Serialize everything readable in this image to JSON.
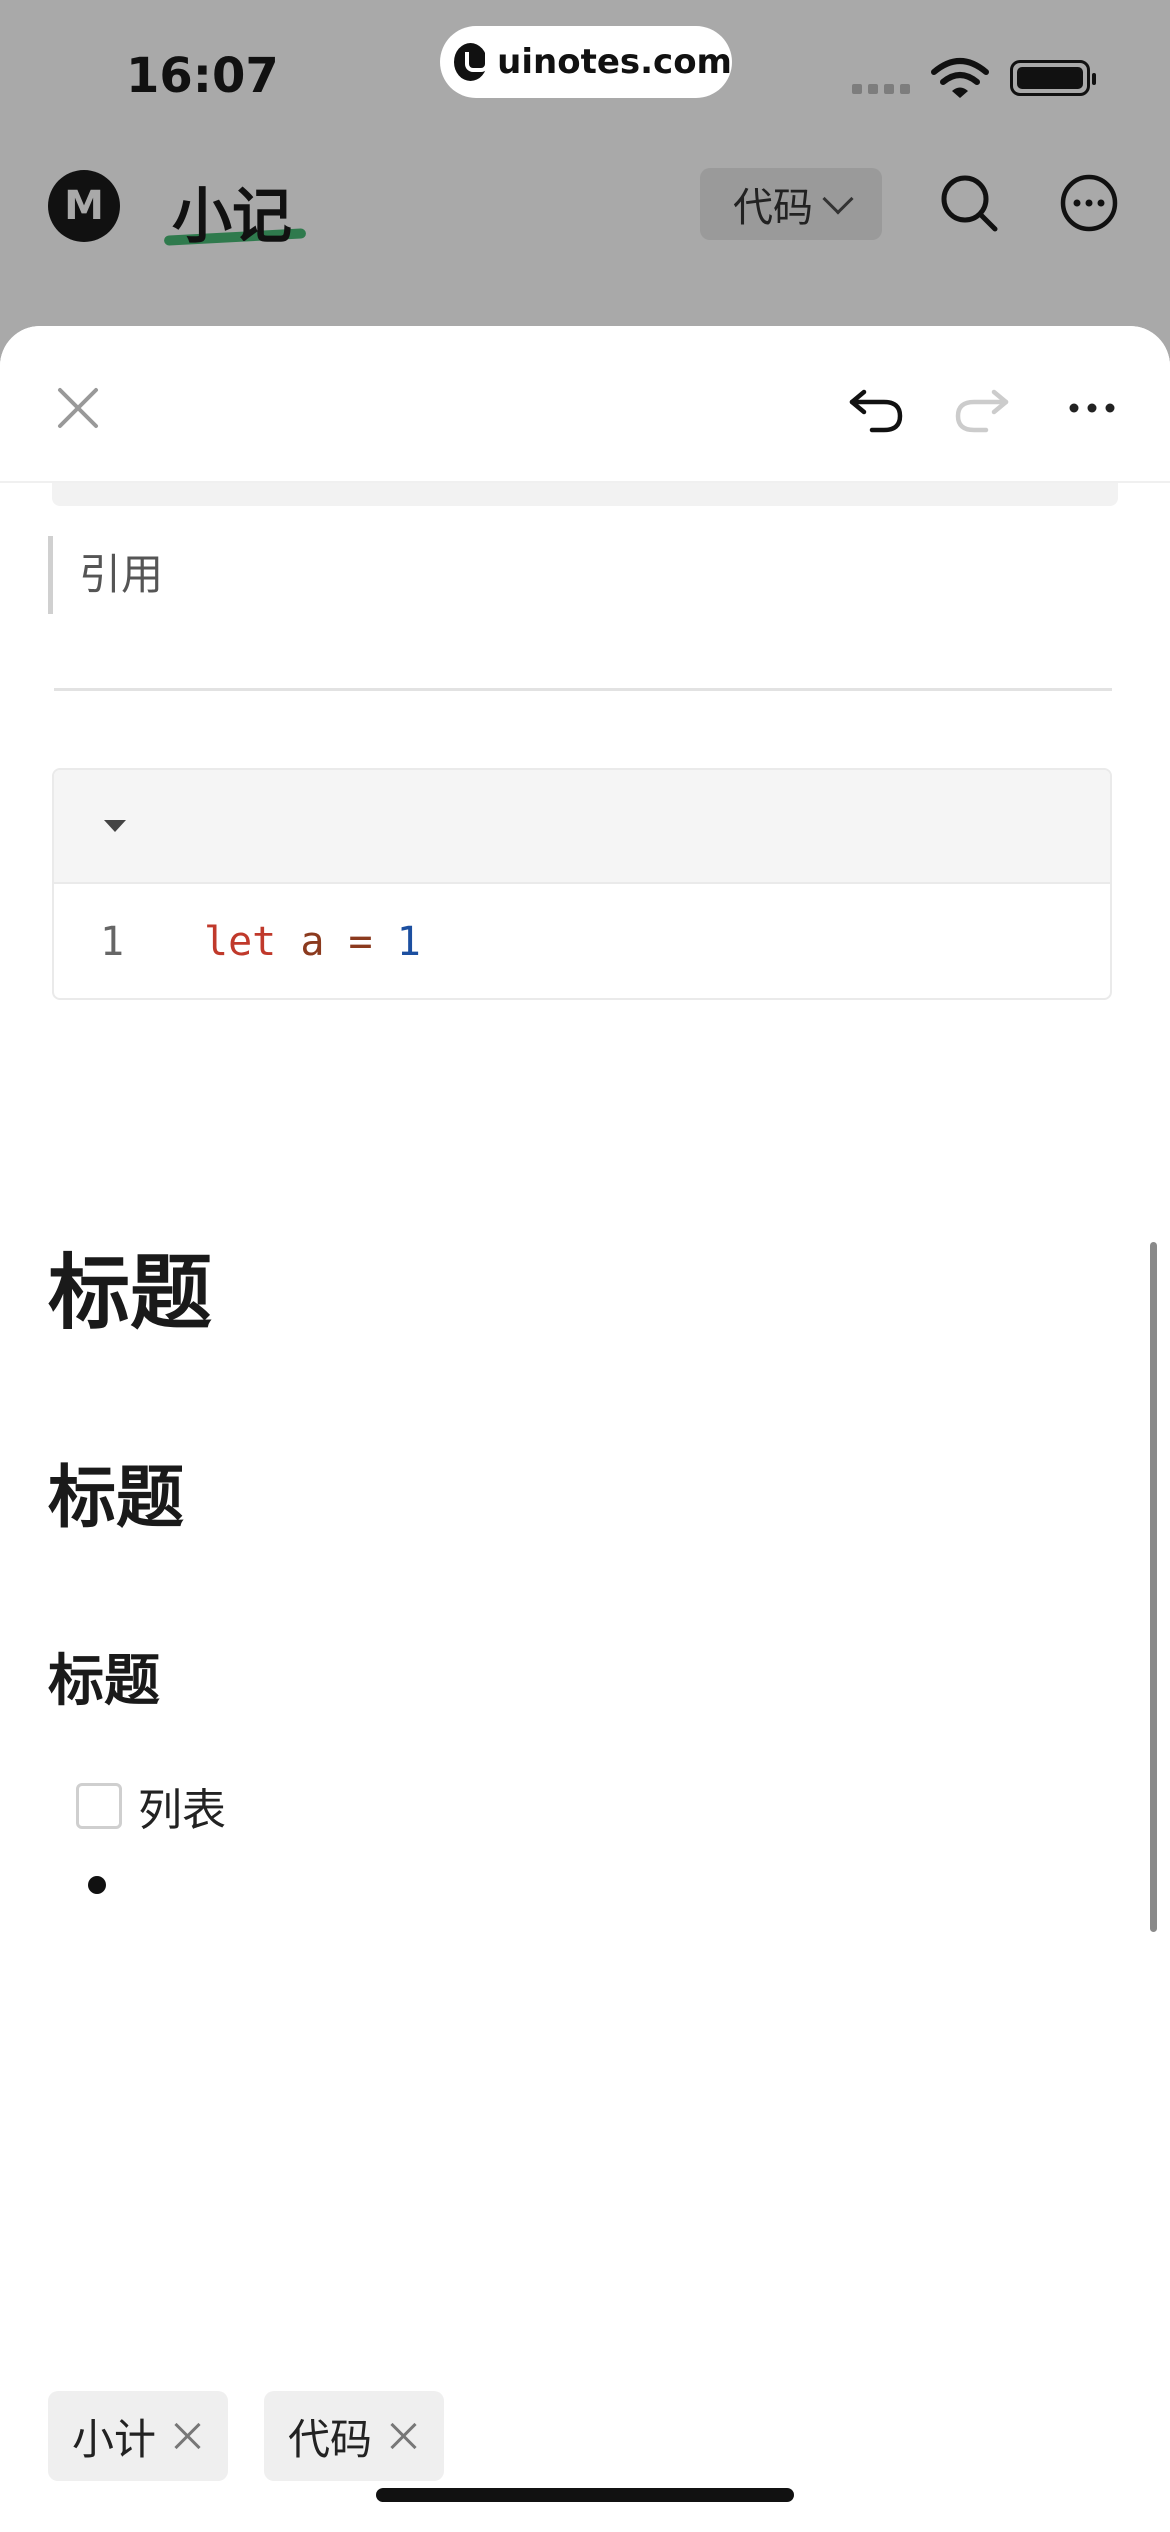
{
  "status_bar": {
    "time": "16:07",
    "url": "uinotes.com"
  },
  "app_header": {
    "logo": "M",
    "title": "小记",
    "filter_label": "代码"
  },
  "editor": {
    "quote": "引用",
    "code": {
      "line_number": "1",
      "kw": "let",
      "var": "a",
      "op": "=",
      "num": "1"
    },
    "heading1": "标题",
    "heading2": "标题",
    "heading3": "标题",
    "todo_label": "列表"
  },
  "tags": [
    {
      "label": "小计"
    },
    {
      "label": "代码"
    }
  ]
}
